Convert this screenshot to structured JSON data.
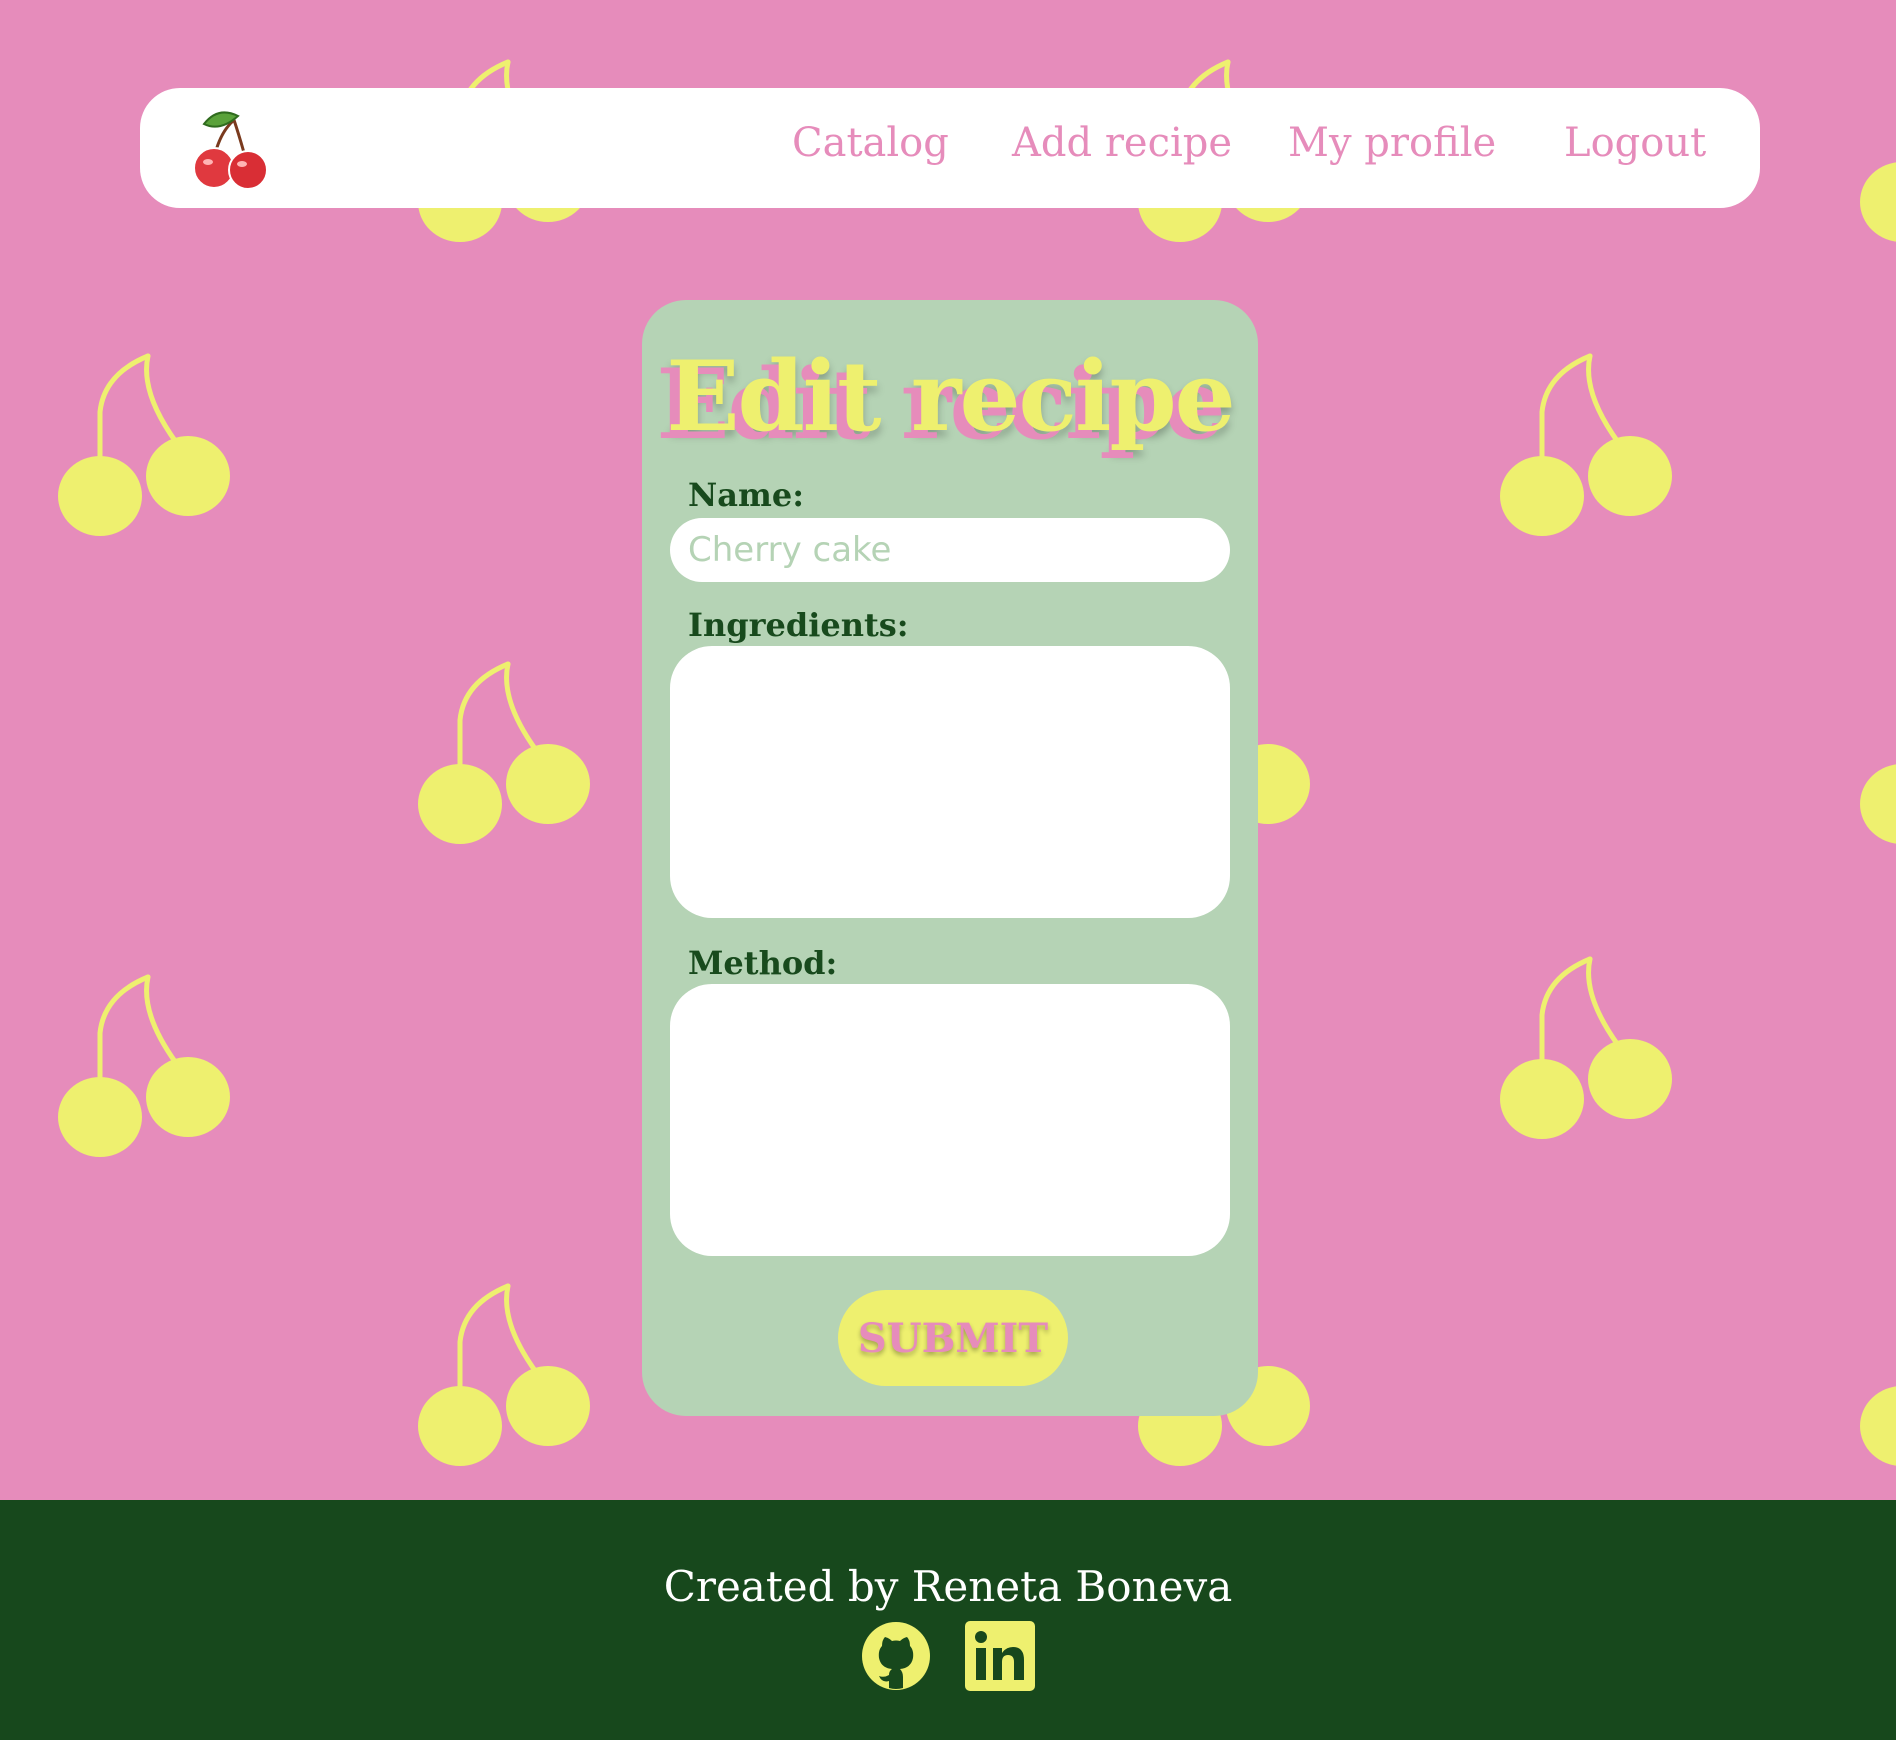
{
  "navbar": {
    "logo_icon": "cherry-logo-icon",
    "links": {
      "catalog": "Catalog",
      "add_recipe": "Add recipe",
      "my_profile": "My profile",
      "logout": "Logout"
    }
  },
  "form": {
    "title": "Edit recipe",
    "name_label": "Name:",
    "name_value": "",
    "name_placeholder": "Cherry cake",
    "ingredients_label": "Ingredients:",
    "ingredients_value": "",
    "method_label": "Method:",
    "method_value": "",
    "submit_label": "SUBMIT"
  },
  "footer": {
    "text": "Created by Reneta Boneva",
    "icons": [
      "github-icon",
      "linkedin-icon"
    ]
  },
  "colors": {
    "background": "#e68cbb",
    "cherry_pattern": "#eef06f",
    "card": "#b5d3b5",
    "label_text": "#184a1d",
    "footer": "#17481c",
    "accent_yellow": "#eef06f",
    "accent_pink": "#e68cbb"
  }
}
